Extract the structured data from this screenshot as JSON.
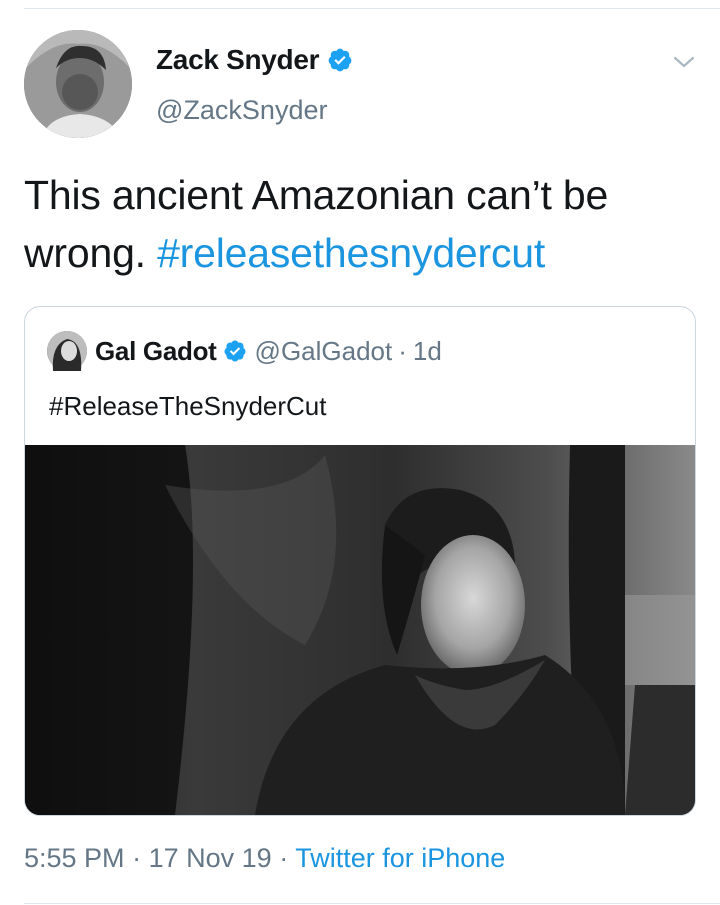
{
  "author": {
    "display_name": "Zack Snyder",
    "handle": "@ZackSnyder"
  },
  "tweet": {
    "text": "This ancient Amazonian can’t be wrong. ",
    "hashtag": "#releasethesnydercut"
  },
  "quoted": {
    "display_name": "Gal Gadot",
    "handle": "@GalGadot",
    "separator": "·",
    "age": "1d",
    "text": "#ReleaseTheSnyderCut"
  },
  "footer": {
    "time": "5:55 PM",
    "separator1": "·",
    "date": "17 Nov 19",
    "separator2": "·",
    "source": "Twitter for iPhone"
  },
  "icons": {
    "verified": "verified-badge-icon",
    "more": "chevron-down-icon"
  },
  "colors": {
    "link": "#1b95e0",
    "secondary_text": "#657786",
    "primary_text": "#14171a",
    "verified": "#1da1f2"
  }
}
